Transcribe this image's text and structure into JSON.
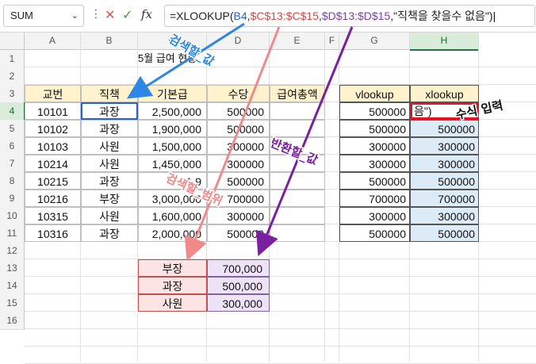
{
  "formula_bar": {
    "name_box": "SUM",
    "fx_label": "fx",
    "formula_parts": [
      {
        "text": "=XLOOKUP(",
        "color": "#222222"
      },
      {
        "text": "B4",
        "color": "#2b64c4"
      },
      {
        "text": ",",
        "color": "#222222"
      },
      {
        "text": "$C$13:$C$15",
        "color": "#d24a4a"
      },
      {
        "text": ",",
        "color": "#222222"
      },
      {
        "text": "$D$13:$D$15",
        "color": "#7b3fa0"
      },
      {
        "text": ",\"직책을 찾을수 없음\")",
        "color": "#222222"
      }
    ]
  },
  "columns": [
    "A",
    "B",
    "C",
    "D",
    "E",
    "F",
    "G",
    "H"
  ],
  "rows": [
    "1",
    "2",
    "3",
    "4",
    "5",
    "6",
    "7",
    "8",
    "9",
    "10",
    "11",
    "12",
    "13",
    "14",
    "15",
    "16"
  ],
  "title": "5월 급여 현황",
  "table": {
    "headers": [
      "교번",
      "직책",
      "기본급",
      "수당",
      "급여총액"
    ],
    "rows": [
      [
        "10101",
        "과장",
        "2,500,000",
        "500000",
        ""
      ],
      [
        "10102",
        "과장",
        "1,900,000",
        "500000",
        ""
      ],
      [
        "10103",
        "사원",
        "1,500,000",
        "300000",
        ""
      ],
      [
        "10214",
        "사원",
        "1,450,000",
        "300000",
        ""
      ],
      [
        "10215",
        "과장",
        "1,9",
        "500000",
        ""
      ],
      [
        "10216",
        "부장",
        "3,000,000",
        "700000",
        ""
      ],
      [
        "10315",
        "사원",
        "1,600,000",
        "300000",
        ""
      ],
      [
        "10316",
        "과장",
        "2,000,000",
        "500000",
        ""
      ]
    ]
  },
  "lookup_table": {
    "headers": [
      "vlookup",
      "xlookup"
    ],
    "rows": [
      [
        "500000",
        "음\")"
      ],
      [
        "500000",
        "500000"
      ],
      [
        "300000",
        "300000"
      ],
      [
        "300000",
        "300000"
      ],
      [
        "500000",
        "500000"
      ],
      [
        "700000",
        "700000"
      ],
      [
        "300000",
        "300000"
      ],
      [
        "500000",
        "500000"
      ]
    ]
  },
  "ref_table": {
    "rows": [
      [
        "부장",
        "700,000"
      ],
      [
        "과장",
        "500,000"
      ],
      [
        "사원",
        "300,000"
      ]
    ]
  },
  "annotations": {
    "search_value": "검색할_값",
    "search_range": "검색할_범위",
    "return_value": "반환할_값",
    "formula_input": "수식 입력"
  },
  "colors": {
    "header_fill": "#fff2cc",
    "lookup_fill": "#ddebf7",
    "ref_fill": "#fce4e4",
    "ref_fill2": "#ede2f6",
    "arrow_blue": "#2e86e6",
    "arrow_pink": "#f08a8a",
    "arrow_purple": "#7a1fa0",
    "excel_green": "#217346",
    "input_box": "#e81123"
  }
}
